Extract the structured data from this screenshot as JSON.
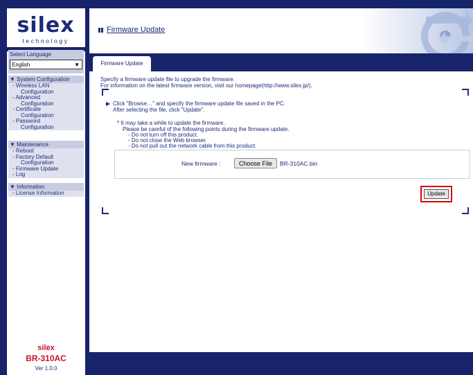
{
  "brand": {
    "logo_text": "silex",
    "logo_subtext": "technology",
    "product_line1": "silex",
    "product_line2": "BR-310AC",
    "version": "Ver 1.0.0"
  },
  "language": {
    "label": "Select Language",
    "selected": "English"
  },
  "menu": {
    "system": {
      "head": "▼ System Configuration",
      "items": [
        "- Wireless LAN",
        "Configuration",
        "- Advanced",
        "Configuration",
        "- Certificate",
        "Configuration",
        "- Password",
        "Configuration"
      ]
    },
    "maintenance": {
      "head": "▼ Maintenance",
      "items": [
        "- Reboot",
        "- Factory Default",
        "Configuration",
        "- Firmware Update",
        "- Log"
      ]
    },
    "information": {
      "head": "▼ Information",
      "items": [
        "- License Information"
      ]
    }
  },
  "page": {
    "title": "Firmware Update",
    "tab": "Firmware Update"
  },
  "intro": {
    "line1": "Specify a firmware update file to upgrade the firmware.",
    "line2": "For information on the latest firmware version, visit our homepage(http://www.silex.jp/)."
  },
  "instructions": {
    "step1": "Click \"Browse…\" and specify the firmware update file saved in the PC.",
    "step1b": "After selecting the file, click \"Update\".",
    "note_head": "* It may take a while to update the firmware.",
    "note_sub": "Please be careful of the following points during the firmware update.",
    "note1": "- Do not turn off this product.",
    "note2": "- Do not close the Web browser.",
    "note3": "- Do not pull out the network cable from this product."
  },
  "firmware": {
    "label": "New firmware :",
    "choose_button": "Choose File",
    "filename": "BR-310AC.bin"
  },
  "update_button": "Update",
  "colors": {
    "navy": "#17236b",
    "accent_red": "#e00000"
  }
}
